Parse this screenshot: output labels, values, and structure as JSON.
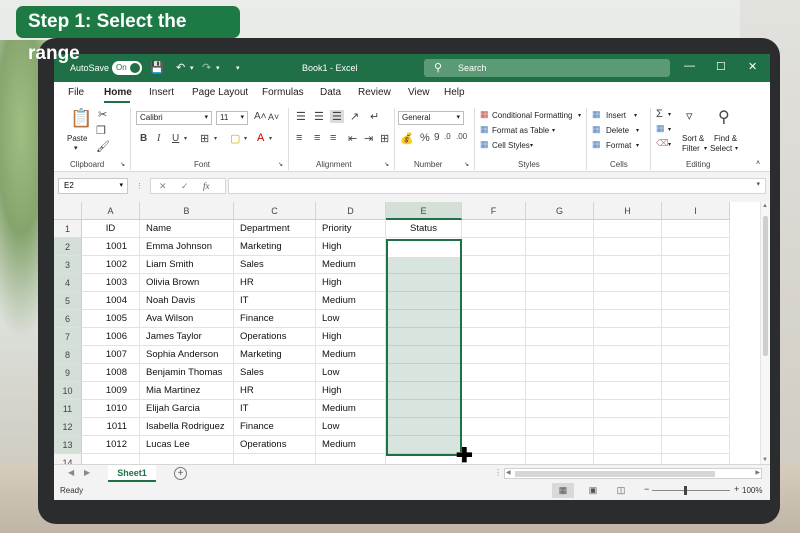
{
  "banner": "Step 1: Select the range",
  "titlebar": {
    "autosave_label": "AutoSave",
    "autosave_state": "On",
    "title": "Book1 - Excel",
    "search_placeholder": "Search"
  },
  "menu": [
    "File",
    "Home",
    "Insert",
    "Page Layout",
    "Formulas",
    "Data",
    "Review",
    "View",
    "Help"
  ],
  "ribbon": {
    "clipboard": {
      "paste": "Paste",
      "label": "Clipboard"
    },
    "font": {
      "name": "Calibri",
      "size": "11",
      "label": "Font"
    },
    "alignment": {
      "label": "Alignment"
    },
    "number": {
      "format": "General",
      "label": "Number"
    },
    "styles": {
      "conditional": "Conditional Formatting",
      "table": "Format as Table",
      "cell": "Cell Styles",
      "label": "Styles"
    },
    "cells": {
      "insert": "Insert",
      "delete": "Delete",
      "format": "Format",
      "label": "Cells"
    },
    "editing": {
      "sort": "Sort &",
      "filter": "Filter",
      "find": "Find &",
      "select": "Select",
      "label": "Editing"
    }
  },
  "formula_bar": {
    "name_box": "E2",
    "fx": "fx",
    "value": ""
  },
  "columns": [
    "A",
    "B",
    "C",
    "D",
    "E",
    "F",
    "G",
    "H",
    "I"
  ],
  "rows": [
    "1",
    "2",
    "3",
    "4",
    "5",
    "6",
    "7",
    "8",
    "9",
    "10",
    "11",
    "12",
    "13",
    "14"
  ],
  "table": {
    "headers": [
      "ID",
      "Name",
      "Department",
      "Priority",
      "Status"
    ],
    "rows": [
      [
        "1001",
        "Emma Johnson",
        "Marketing",
        "High"
      ],
      [
        "1002",
        "Liam Smith",
        "Sales",
        "Medium"
      ],
      [
        "1003",
        "Olivia Brown",
        "HR",
        "High"
      ],
      [
        "1004",
        "Noah Davis",
        "IT",
        "Medium"
      ],
      [
        "1005",
        "Ava Wilson",
        "Finance",
        "Low"
      ],
      [
        "1006",
        "James Taylor",
        "Operations",
        "High"
      ],
      [
        "1007",
        "Sophia Anderson",
        "Marketing",
        "Medium"
      ],
      [
        "1008",
        "Benjamin Thomas",
        "Sales",
        "Low"
      ],
      [
        "1009",
        "Mia Martinez",
        "HR",
        "High"
      ],
      [
        "1010",
        "Elijah Garcia",
        "IT",
        "Medium"
      ],
      [
        "1011",
        "Isabella Rodriguez",
        "Finance",
        "Low"
      ],
      [
        "1012",
        "Lucas Lee",
        "Operations",
        "Medium"
      ]
    ]
  },
  "selection": {
    "range": "E2:E13"
  },
  "sheet_tabs": {
    "active": "Sheet1"
  },
  "status": {
    "ready": "Ready",
    "zoom": "100%"
  },
  "colors": {
    "excel_green": "#1f7046",
    "banner_green": "#1d7a45"
  }
}
